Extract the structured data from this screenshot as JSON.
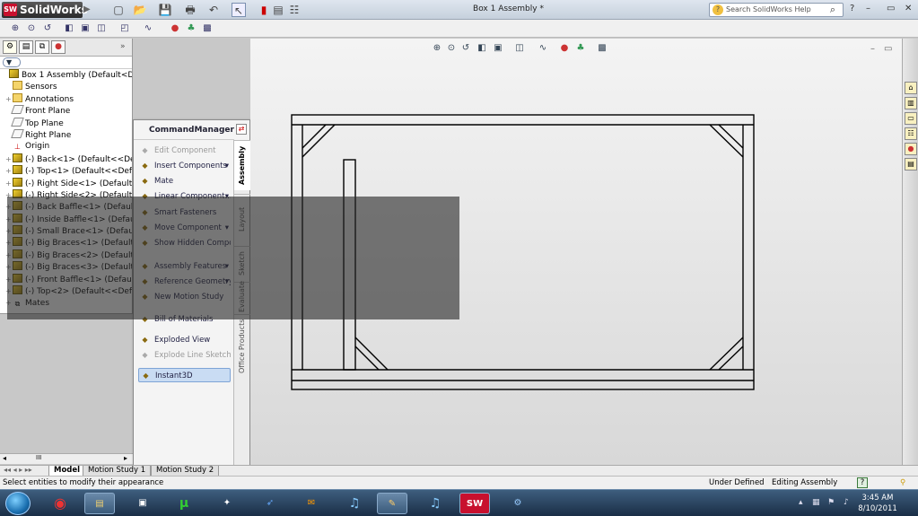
{
  "app": {
    "logo_text": "SolidWorks",
    "logo_mark": "SW",
    "document_title": "Box 1 Assembly *",
    "search_placeholder": "Search SolidWorks Help",
    "help_label": "?"
  },
  "feature_tree": {
    "items": [
      {
        "label": "Box 1 Assembly  (Default<Display",
        "icon": "assembly-icon",
        "expand": ""
      },
      {
        "label": "Sensors",
        "icon": "sensors-folder-icon",
        "expand": ""
      },
      {
        "label": "Annotations",
        "icon": "annotations-icon",
        "expand": "+"
      },
      {
        "label": "Front Plane",
        "icon": "plane-icon",
        "expand": ""
      },
      {
        "label": "Top Plane",
        "icon": "plane-icon",
        "expand": ""
      },
      {
        "label": "Right Plane",
        "icon": "plane-icon",
        "expand": ""
      },
      {
        "label": "Origin",
        "icon": "origin-icon",
        "expand": ""
      },
      {
        "label": "(-) Back<1> (Default<<Defau",
        "icon": "part-icon",
        "expand": "+"
      },
      {
        "label": "(-) Top<1> (Default<<Defau",
        "icon": "part-icon",
        "expand": "+"
      },
      {
        "label": "(-) Right Side<1> (Default<<",
        "icon": "part-icon",
        "expand": "+"
      },
      {
        "label": "(-) Right Side<2> (Default<<",
        "icon": "part-icon",
        "expand": "+"
      },
      {
        "label": "(-) Back Baffle<1> (Default<<",
        "icon": "part-icon",
        "expand": "+"
      },
      {
        "label": "(-) Inside Baffle<1> (Default",
        "icon": "part-icon",
        "expand": "+"
      },
      {
        "label": "(-) Small Brace<1> (Default<",
        "icon": "part-icon",
        "expand": "+"
      },
      {
        "label": "(-) Big Braces<1> (Default<<",
        "icon": "part-icon",
        "expand": "+"
      },
      {
        "label": "(-) Big Braces<2> (Default<<",
        "icon": "part-icon",
        "expand": "+"
      },
      {
        "label": "(-) Big Braces<3> (Default<<",
        "icon": "part-icon",
        "expand": "+"
      },
      {
        "label": "(-) Front Baffle<1> (Default",
        "icon": "part-icon",
        "expand": "+"
      },
      {
        "label": "(-) Top<2> (Default<<Defau",
        "icon": "part-icon",
        "expand": "+"
      },
      {
        "label": "Mates",
        "icon": "mates-icon",
        "expand": "+"
      }
    ]
  },
  "command_manager": {
    "title": "CommandManager",
    "items": [
      {
        "label": "Edit Component",
        "state": "dim",
        "icon": "edit-component-icon"
      },
      {
        "label": "Insert Components",
        "state": "normal",
        "icon": "insert-components-icon",
        "arrow": "▾"
      },
      {
        "label": "Mate",
        "state": "normal",
        "icon": "mate-icon"
      },
      {
        "label": "Linear Component...",
        "state": "normal",
        "icon": "linear-pattern-icon",
        "arrow": "▾"
      },
      {
        "label": "Smart Fasteners",
        "state": "normal",
        "icon": "smart-fasteners-icon"
      },
      {
        "label": "Move Component",
        "state": "normal",
        "icon": "move-component-icon",
        "arrow": "▾"
      },
      {
        "label": "Show Hidden Compo...",
        "state": "normal",
        "icon": "show-hidden-icon"
      },
      {
        "label": "Assembly Features",
        "state": "normal",
        "icon": "assembly-features-icon",
        "arrow": "▾"
      },
      {
        "label": "Reference Geometry",
        "state": "normal",
        "icon": "reference-geometry-icon",
        "arrow": "▾"
      },
      {
        "label": "New Motion Study",
        "state": "normal",
        "icon": "motion-study-icon"
      },
      {
        "label": "Bill of Materials",
        "state": "normal",
        "icon": "bom-icon"
      },
      {
        "label": "Exploded View",
        "state": "normal",
        "icon": "exploded-view-icon"
      },
      {
        "label": "Explode Line Sketch",
        "state": "dim",
        "icon": "explode-line-icon"
      },
      {
        "label": "Instant3D",
        "state": "sel",
        "icon": "instant3d-icon"
      }
    ],
    "tabs": [
      "Assembly",
      "Layout",
      "Sketch",
      "Evaluate",
      "Office Products"
    ]
  },
  "bottom_tabs": [
    "Model",
    "Motion Study 1",
    "Motion Study 2"
  ],
  "status": {
    "message": "Select entities to modify their appearance",
    "state1": "Under Defined",
    "state2": "Editing Assembly",
    "help": "?"
  },
  "clock": {
    "time": "3:45 AM",
    "date": "8/10/2011"
  },
  "scroll_label": "III"
}
